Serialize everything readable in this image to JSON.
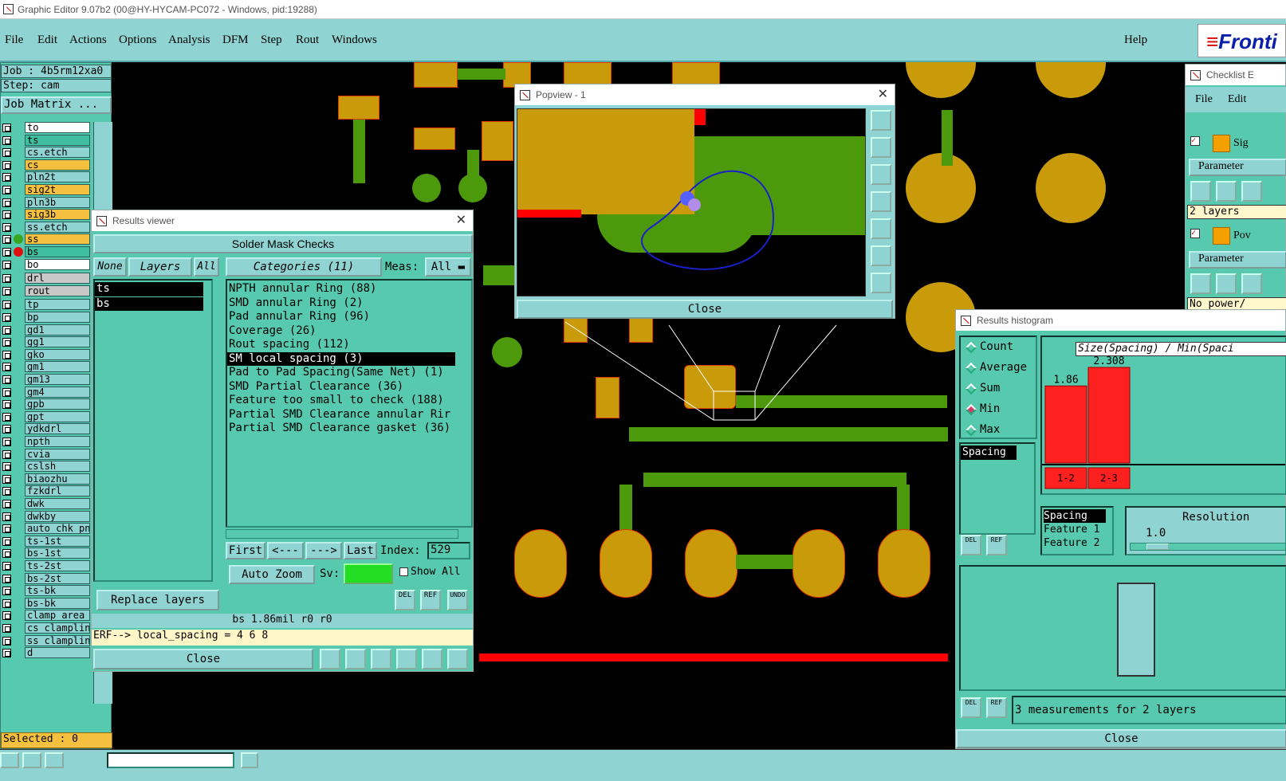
{
  "app": {
    "title": "Graphic Editor 9.07b2 (00@HY-HYCAM-PC072 - Windows, pid:19288)"
  },
  "menu": {
    "items": [
      "File",
      "Edit",
      "Actions",
      "Options",
      "Analysis",
      "DFM",
      "Step",
      "Rout",
      "Windows"
    ],
    "help": "Help",
    "logo": "Fronti"
  },
  "job": {
    "job": "Job : 4b5rm12xa0",
    "step": "Step: cam",
    "matrix_btn": "Job Matrix ...",
    "selected": "Selected : 0"
  },
  "layers": [
    "to",
    "ts",
    "cs.etch",
    "cs",
    "pln2t",
    "sig2t",
    "pln3b",
    "sig3b",
    "ss.etch",
    "ss",
    "bs",
    "bo",
    "drl",
    "rout",
    "tp",
    "bp",
    "gd1",
    "gg1",
    "gko",
    "gm1",
    "gm13",
    "gm4",
    "gpb",
    "gpt",
    "ydkdrl",
    "npth",
    "cvia",
    "cslsh",
    "biaozhu",
    "fzkdrl",
    "dwk",
    "dwkby",
    "auto_chk_pn",
    "ts-1st",
    "bs-1st",
    "ts-2st",
    "bs-2st",
    "ts-bk",
    "bs-bk",
    "clamp_area",
    "cs_clampline",
    "ss_clampline",
    "d"
  ],
  "results_viewer": {
    "title": "Results viewer",
    "header": "Solder Mask Checks",
    "none": "None",
    "layers_label": "Layers",
    "all": "All",
    "layer_list": [
      "ts",
      "bs"
    ],
    "categories_btn": "Categories (11)",
    "meas_label": "Meas:",
    "meas_value": "All",
    "categories": [
      "NPTH annular Ring (88)",
      "SMD annular Ring (2)",
      "Pad annular Ring (96)",
      "Coverage (26)",
      "Rout spacing (112)",
      "SM local spacing (3)",
      "Pad to Pad Spacing(Same Net) (1)",
      "SMD Partial Clearance (36)",
      "Feature too small to check (188)",
      "Partial SMD Clearance annular Rir",
      "Partial SMD Clearance gasket (36)"
    ],
    "selected_category": 5,
    "first": "First",
    "prev": "<---",
    "next": "--->",
    "last": "Last",
    "index_label": "Index:",
    "index_value": "529",
    "auto_zoom": "Auto Zoom",
    "sv": "Sv:",
    "show_all": "Show All",
    "replace_layers": "Replace layers",
    "del": "DEL",
    "ref": "REF",
    "undo": "UNDO",
    "status": "bs 1.86mil  r0  r0",
    "erf": "ERF--> local_spacing = 4 6 8",
    "close": "Close"
  },
  "popview": {
    "title": "Popview - 1",
    "close": "Close"
  },
  "checklist": {
    "title": "Checklist E",
    "file": "File",
    "edit": "Edit",
    "sig": "Sig",
    "pov": "Pov",
    "parameters": "Parameter",
    "layers": "2 layers",
    "no_power": "No power/"
  },
  "histogram": {
    "title": "Results histogram",
    "options": [
      "Count",
      "Average",
      "Sum",
      "Min",
      "Max"
    ],
    "selected_option": 3,
    "chart_title": "Size(Spacing) / Min(Spaci",
    "meas_list": [
      "Spacing"
    ],
    "sort_list": [
      "Spacing",
      "Feature 1",
      "Feature 2"
    ],
    "resolution_label": "Resolution",
    "resolution_value": "1.0",
    "status": "3 measurements for 2 layers",
    "close": "Close",
    "del": "DEL",
    "ref": "REF"
  },
  "chart_data": {
    "type": "bar",
    "title": "Size(Spacing) / Min(Spaci",
    "categories": [
      "1-2",
      "2-3"
    ],
    "values": [
      1.86,
      2.308
    ],
    "value_labels": [
      "1.86",
      "2.308"
    ],
    "colors": {
      "bar": "#ff2020"
    }
  },
  "colors": {
    "panel": "#8fd4d2",
    "window": "#56c9ae",
    "copper": "#c99a09",
    "trace": "#4c9a0c",
    "highlight": "#ff0000"
  }
}
